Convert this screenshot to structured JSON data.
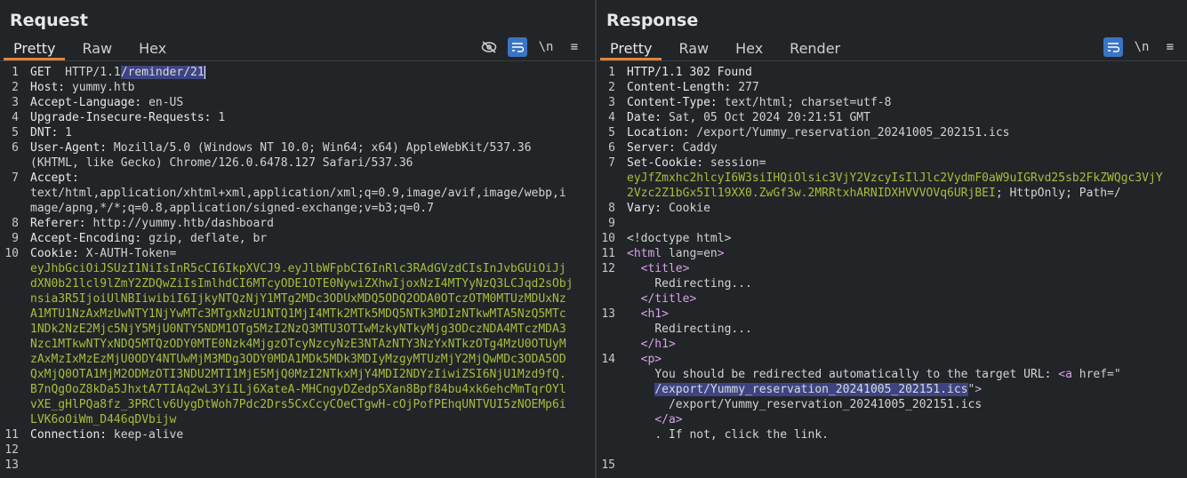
{
  "request": {
    "title": "Request",
    "tabs": [
      "Pretty",
      "Raw",
      "Hex"
    ],
    "tools": {
      "hide": "hide-nonprintable",
      "wrap": "wrap-lines",
      "newline": "\\n",
      "menu": "≡"
    },
    "lines": [
      {
        "n": "1",
        "name": "GET ",
        "sel": "/reminder/21",
        "val": " HTTP/1.1"
      },
      {
        "n": "2",
        "name": "Host: ",
        "val": "yummy.htb"
      },
      {
        "n": "3",
        "name": "Accept-Language: ",
        "val": "en-US"
      },
      {
        "n": "4",
        "name": "Upgrade-Insecure-Requests: ",
        "val": "1"
      },
      {
        "n": "5",
        "name": "DNT: ",
        "val": "1"
      },
      {
        "n": "6",
        "name": "User-Agent: ",
        "val": "Mozilla/5.0 (Windows NT 10.0; Win64; x64) AppleWebKit/537.36"
      },
      {
        "n": "",
        "name": "",
        "val": "(KHTML, like Gecko) Chrome/126.0.6478.127 Safari/537.36"
      },
      {
        "n": "7",
        "name": "Accept: ",
        "val": ""
      },
      {
        "n": "",
        "name": "",
        "val": "text/html,application/xhtml+xml,application/xml;q=0.9,image/avif,image/webp,i"
      },
      {
        "n": "",
        "name": "",
        "val": "mage/apng,*/*;q=0.8,application/signed-exchange;v=b3;q=0.7"
      },
      {
        "n": "8",
        "name": "Referer: ",
        "val": "http://yummy.htb/dashboard"
      },
      {
        "n": "9",
        "name": "Accept-Encoding: ",
        "val": "gzip, deflate, br"
      },
      {
        "n": "10",
        "name": "Cookie: ",
        "val": "X-AUTH-Token="
      },
      {
        "n": "",
        "name": "",
        "jwt": "eyJhbGciOiJSUzI1NiIsInR5cCI6IkpXVCJ9.eyJlbWFpbCI6InRlc3RAdGVzdCIsInJvbGUiOiJj"
      },
      {
        "n": "",
        "name": "",
        "jwt": "dXN0b21lcl9lZmY2ZDQwZiIsImlhdCI6MTcyODE1OTE0NywiZXhwIjoxNzI4MTYyNzQ3LCJqd2sObj"
      },
      {
        "n": "",
        "name": "",
        "jwt": "nsia3R5IjoiUlNBIiwibiI6IjkyNTQzNjY1MTg2MDc3ODUxMDQ5ODQ2ODA0OTczOTM0MTUzMDUxNz"
      },
      {
        "n": "",
        "name": "",
        "jwt": "A1MTU1NzAxMzUwNTY1NjYwMTc3MTgxNzU1NTQ1MjI4MTk2MTk5MDQ5NTk3MDIzNTkwMTA5NzQ5MTc"
      },
      {
        "n": "",
        "name": "",
        "jwt": "1NDk2NzE2Mjc5NjY5MjU0NTY5NDM1OTg5MzI2NzQ3MTU3OTIwMzkyNTkyMjg3ODczNDA4MTczMDA3"
      },
      {
        "n": "",
        "name": "",
        "jwt": "Nzc1MTkwNTYxNDQ5MTQzODY0MTE0Nzk4MjgzOTcyNzcyNzE3NTAzNTY3NzYxNTkzOTg4MzU0OTUyM"
      },
      {
        "n": "",
        "name": "",
        "jwt": "zAxMzIxMzEzMjU0ODY4NTUwMjM3MDg3ODY0MDA1MDk5MDk3MDIyMzgyMTUzMjY2MjQwMDc3ODA5OD"
      },
      {
        "n": "",
        "name": "",
        "jwt": "QxMjQ0OTA1MjM2ODMzOTI3NDU2MTI1MjE5MjQ0MzI2NTkxMjY4MDI2NDYzIiwiZSI6NjU1Mzd9fQ."
      },
      {
        "n": "",
        "name": "",
        "jwt": "B7nQgOoZ8kDa5JhxtA7TIAq2wL3YiILj6XateA-MHCngyDZedp5Xan8Bpf84bu4xk6ehcMmTqrOYl"
      },
      {
        "n": "",
        "name": "",
        "jwt": "vXE_gHlPQa8fz_3PRClv6UygDtWoh7Pdc2Drs5CxCcyCOeCTgwH-cOjPofPEhqUNTVUI5zNOEMp6i"
      },
      {
        "n": "",
        "name": "",
        "jwt": "LVK6oOiWm_D446qDVbijw"
      },
      {
        "n": "11",
        "name": "Connection: ",
        "val": "keep-alive"
      },
      {
        "n": "12",
        "name": "",
        "val": ""
      },
      {
        "n": "13",
        "name": "",
        "val": ""
      }
    ]
  },
  "response": {
    "title": "Response",
    "tabs": [
      "Pretty",
      "Raw",
      "Hex",
      "Render"
    ],
    "tools": {
      "wrap": "wrap-lines",
      "newline": "\\n",
      "menu": "≡"
    },
    "lines": [
      {
        "n": "1",
        "name": "HTTP/1.1 302 Found",
        "val": ""
      },
      {
        "n": "2",
        "name": "Content-Length: ",
        "val": "277"
      },
      {
        "n": "3",
        "name": "Content-Type: ",
        "val": "text/html; charset=utf-8"
      },
      {
        "n": "4",
        "name": "Date: ",
        "val": "Sat, 05 Oct 2024 20:21:51 GMT"
      },
      {
        "n": "5",
        "name": "Location: ",
        "val": "/export/Yummy_reservation_20241005_202151.ics"
      },
      {
        "n": "6",
        "name": "Server: ",
        "val": "Caddy"
      },
      {
        "n": "7",
        "name": "Set-Cookie: ",
        "val": "session="
      },
      {
        "n": "",
        "name": "",
        "jwt": "eyJfZmxhc2hlcyI6W3siIHQiOlsic3VjY2VzcyIsIlJlc2VydmF0aW9uIGRvd25sb2FkZWQgc3VjY"
      },
      {
        "n": "",
        "name": "",
        "jwt": "2Vzc2Z1bGx5Il19XX0.ZwGf3w.2MRRtxhARNIDXHVVVOVq6URjBEI",
        "tail": "; HttpOnly; Path=/"
      },
      {
        "n": "8",
        "name": "Vary: ",
        "val": "Cookie"
      },
      {
        "n": "9",
        "name": "",
        "val": ""
      },
      {
        "n": "10",
        "name": "",
        "val": "<!doctype html>"
      },
      {
        "n": "11",
        "tag": "<html ",
        "attr": "lang=en",
        "tagEnd": ">"
      },
      {
        "n": "12",
        "indent": "  ",
        "tag": "<title>"
      },
      {
        "n": "",
        "indent": "    ",
        "val": "Redirecting..."
      },
      {
        "n": "",
        "indent": "  ",
        "tag": "</title>"
      },
      {
        "n": "13",
        "indent": "  ",
        "tag": "<h1>"
      },
      {
        "n": "",
        "indent": "    ",
        "val": "Redirecting..."
      },
      {
        "n": "",
        "indent": "  ",
        "tag": "</h1>"
      },
      {
        "n": "14",
        "indent": "  ",
        "tag": "<p>"
      },
      {
        "n": "",
        "indent": "    ",
        "val": "You should be redirected automatically to the target URL: ",
        "tag": "<a ",
        "attr": "href=\""
      },
      {
        "n": "",
        "indent": "    ",
        "sel": "/export/Yummy_reservation_20241005_202151.ics",
        "attr": "\"",
        "tagEnd": ">"
      },
      {
        "n": "",
        "indent": "      ",
        "val": "/export/Yummy_reservation_20241005_202151.ics"
      },
      {
        "n": "",
        "indent": "    ",
        "tag": "</a>"
      },
      {
        "n": "",
        "indent": "    ",
        "val": ". If not, click the link."
      },
      {
        "n": "",
        "name": "",
        "val": ""
      },
      {
        "n": "15",
        "name": "",
        "val": ""
      }
    ]
  }
}
